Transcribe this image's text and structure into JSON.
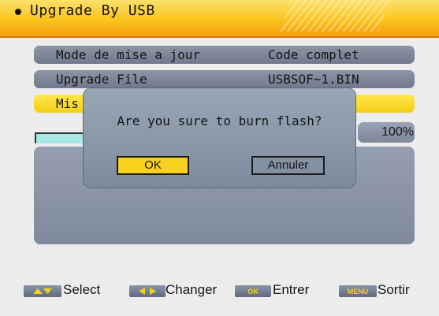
{
  "header": {
    "title": "Upgrade By USB"
  },
  "menu": {
    "rows": [
      {
        "label": "Mode de mise a jour",
        "value": "Code complet"
      },
      {
        "label": "Upgrade File",
        "value": "USBSOF~1.BIN"
      },
      {
        "label": "Mis",
        "value": ""
      }
    ]
  },
  "progress": {
    "percent_text": "100%",
    "fraction": 1.0
  },
  "dialog": {
    "message": "Are you sure to burn flash?",
    "ok_label": "OK",
    "cancel_label": "Annuler"
  },
  "footer": {
    "items": [
      {
        "icon": "up-down-arrows-icon",
        "label": "Select"
      },
      {
        "icon": "left-right-arrows-icon",
        "label": "Changer"
      },
      {
        "icon": "ok-key-icon",
        "label": "Entrer"
      },
      {
        "icon": "menu-key-icon",
        "label": "Sortir"
      }
    ]
  },
  "colors": {
    "accent": "#fbc41e",
    "selected_row": "#f5cf18",
    "panel": "#7f8a9c",
    "progress_fill": "#a9e7e3"
  }
}
